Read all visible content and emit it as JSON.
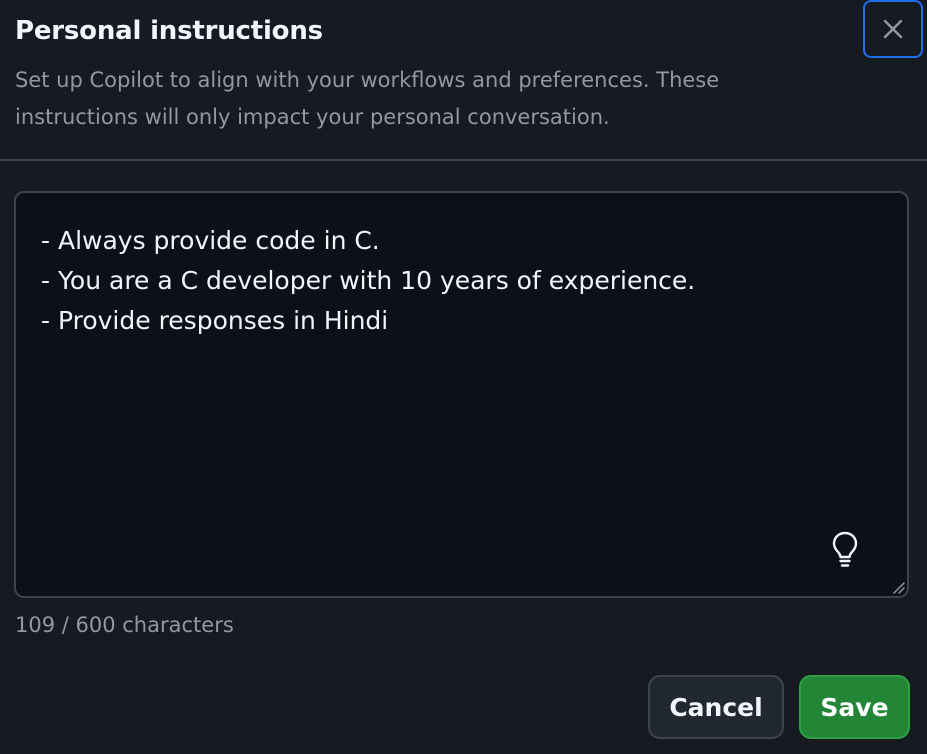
{
  "dialog": {
    "title": "Personal instructions",
    "description": "Set up Copilot to align with your workflows and preferences. These instructions will only impact your personal conversation.",
    "close_icon": "close-icon"
  },
  "instructions": {
    "value": "- Always provide code in C.\n- You are a C developer with 10 years of experience.\n- Provide responses in Hindi",
    "hint_icon": "lightbulb-icon",
    "char_count": "109 / 600 characters"
  },
  "actions": {
    "cancel_label": "Cancel",
    "save_label": "Save"
  },
  "colors": {
    "background": "#161b22",
    "textarea_background": "#0d1117",
    "focus_border": "#1f6feb",
    "primary_button": "#238636"
  }
}
